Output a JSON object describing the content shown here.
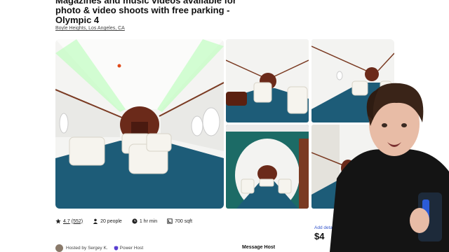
{
  "listing": {
    "title": "Magazines and music videos available for photo & video shoots with free parking - Olympic 4",
    "location": "Boyle Heights, Los Angeles, CA"
  },
  "stats": {
    "rating": "4.7",
    "reviews": "(552)",
    "capacity": "20 people",
    "min_time": "1 hr min",
    "size": "700 sqft"
  },
  "booking": {
    "details_link": "Add details",
    "price": "$4"
  },
  "host": {
    "hosted_by": "Hosted by Sergey K.",
    "badge": "Power Host",
    "message_button": "Message Host"
  },
  "icons": {
    "rating": "star-icon",
    "capacity": "person-icon",
    "min_time": "clock-icon",
    "size": "area-icon",
    "badge": "shield-icon"
  },
  "colors": {
    "carpet": "#1d5c78",
    "wood": "#6b2a1a",
    "link": "#3355cc"
  }
}
